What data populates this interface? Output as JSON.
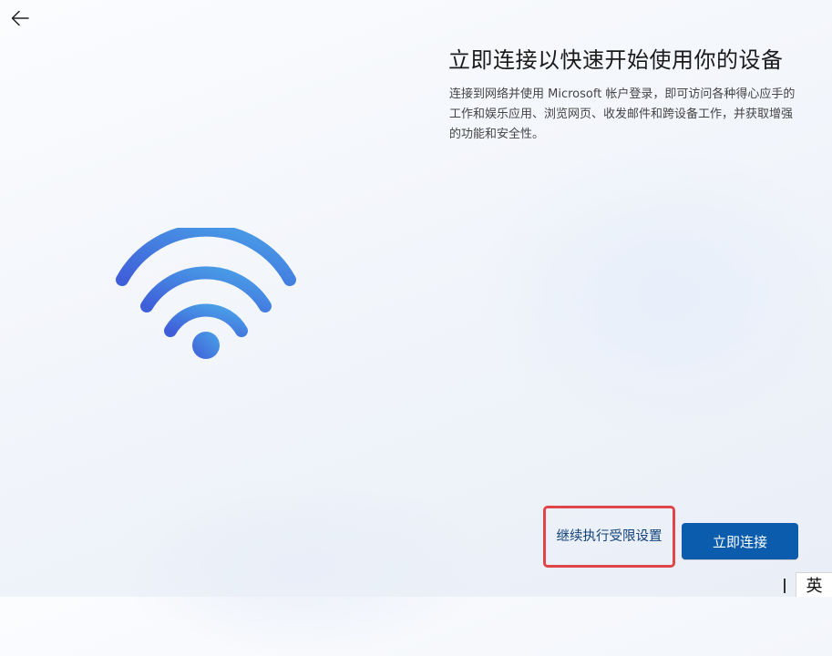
{
  "window": {
    "background_color": "#f3f6fb"
  },
  "navigation": {
    "back_icon": "arrow-left-icon"
  },
  "header": {
    "title": "立即连接以快速开始使用你的设备",
    "description": "连接到网络并使用 Microsoft 帐户登录，即可访问各种得心应手的工作和娱乐应用、浏览网页、收发邮件和跨设备工作，并获取增强的功能和安全性。"
  },
  "illustration": {
    "icon": "wifi-icon",
    "gradient_start": "#3f5fd9",
    "gradient_end": "#4aa3e8"
  },
  "actions": {
    "limited_setup_label": "继续执行受限设置",
    "limited_setup_highlight_color": "#e0454a",
    "connect_label": "立即连接",
    "connect_color": "#0b5cad"
  },
  "taskbar": {
    "ime_label": "英"
  }
}
